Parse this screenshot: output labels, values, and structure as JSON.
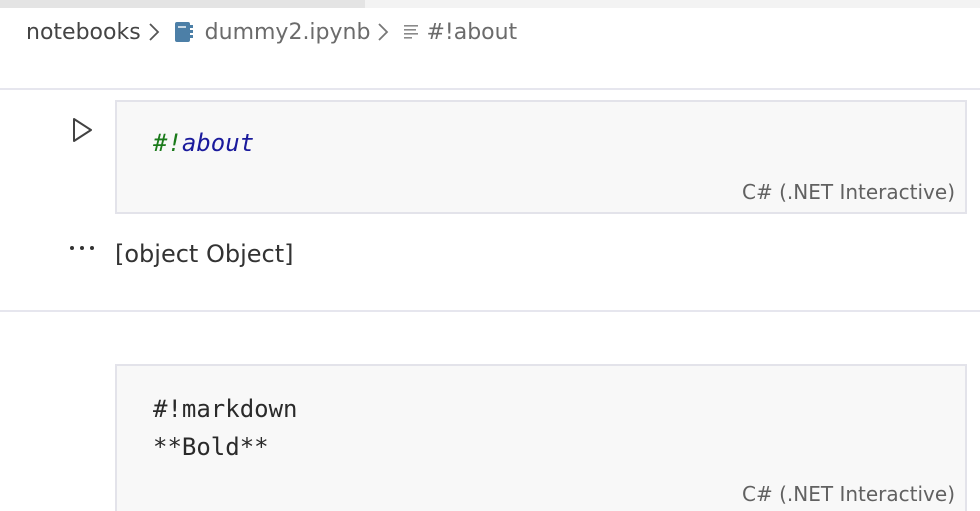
{
  "breadcrumb": {
    "root": "notebooks",
    "file": "dummy2.ipynb",
    "symbol": "#!about",
    "icons": {
      "file": "notebook-icon",
      "symbol": "symbol-text-icon",
      "separator": "chevron-right-icon"
    }
  },
  "cells": [
    {
      "code_parts": {
        "hash": "#!",
        "word": "about"
      },
      "language": "C# (.NET Interactive)",
      "run_icon": "run-triangle-icon",
      "output": {
        "toggle_icon": "ellipsis-icon",
        "text": "[object Object]"
      }
    },
    {
      "code_lines": [
        "#!markdown",
        "**Bold**"
      ],
      "language": "C# (.NET Interactive)"
    }
  ],
  "colors": {
    "notebook_icon": "#4c7fa7",
    "keyword_green": "#1a7a1a",
    "keyword_blue": "#1a1a9c",
    "cell_background": "#f8f8f8",
    "cell_border": "#e3e3ea"
  }
}
